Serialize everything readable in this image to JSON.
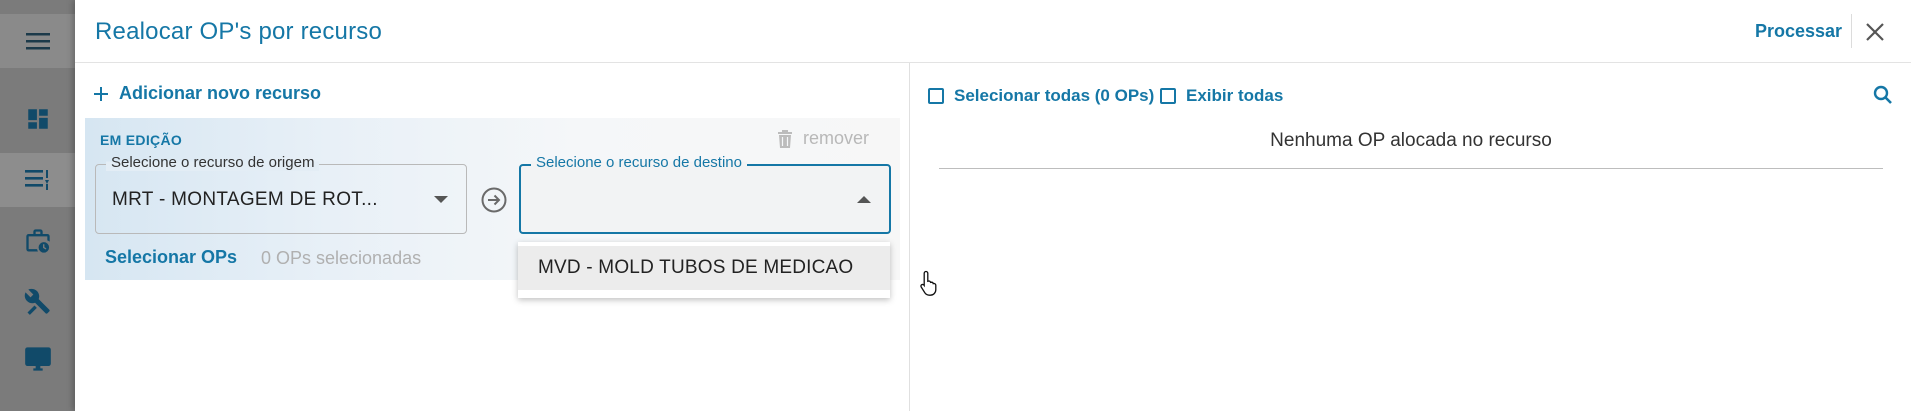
{
  "dialog": {
    "title": "Realocar OP's por recurso",
    "process_label": "Processar",
    "accent_color": "#1577a6"
  },
  "left_pane": {
    "add_resource_label": "Adicionar novo recurso",
    "card": {
      "status_label": "EM EDIÇÃO",
      "remove_label": "remover",
      "origin": {
        "label": "Selecione o recurso de origem",
        "value": "MRT - MONTAGEM DE ROT..."
      },
      "destination": {
        "label": "Selecione o recurso de destino",
        "value": ""
      },
      "select_ops_label": "Selecionar OPs",
      "ops_count_text": "0 OPs selecionadas"
    },
    "dropdown_options": [
      {
        "label": "MVD - MOLD TUBOS DE MEDICAO"
      }
    ]
  },
  "right_pane": {
    "select_all_label": "Selecionar todas (0 OPs)",
    "show_all_label": "Exibir todas",
    "empty_message": "Nenhuma OP alocada no recurso"
  },
  "nav_rail": {
    "icons": [
      "menu-icon",
      "dashboard-icon",
      "list-icon",
      "briefcase-clock-icon",
      "tools-icon",
      "monitor-icon"
    ]
  }
}
